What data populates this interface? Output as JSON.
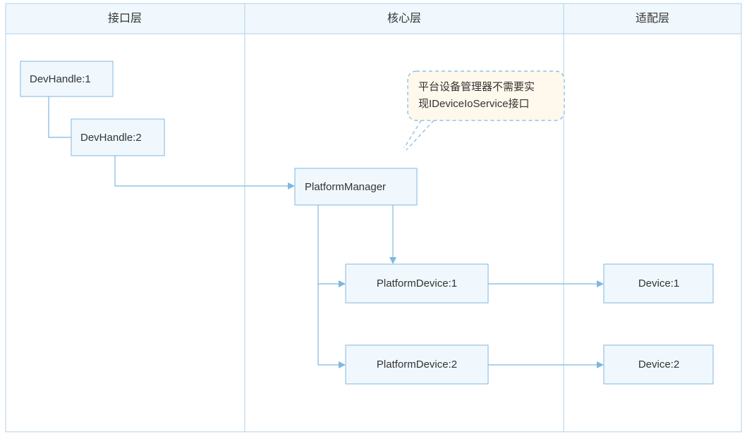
{
  "headers": {
    "col1": "接口层",
    "col2": "核心层",
    "col3": "适配层"
  },
  "devHandle1": "DevHandle:1",
  "devHandle2": "DevHandle:2",
  "platformManager": "PlatformManager",
  "platformDevice1": "PlatformDevice:1",
  "platformDevice2": "PlatformDevice:2",
  "device1": "Device:1",
  "device2": "Device:2",
  "bubble": {
    "line1": "平台设备管理器不需要实",
    "line2": "现IDeviceIoService接口"
  }
}
